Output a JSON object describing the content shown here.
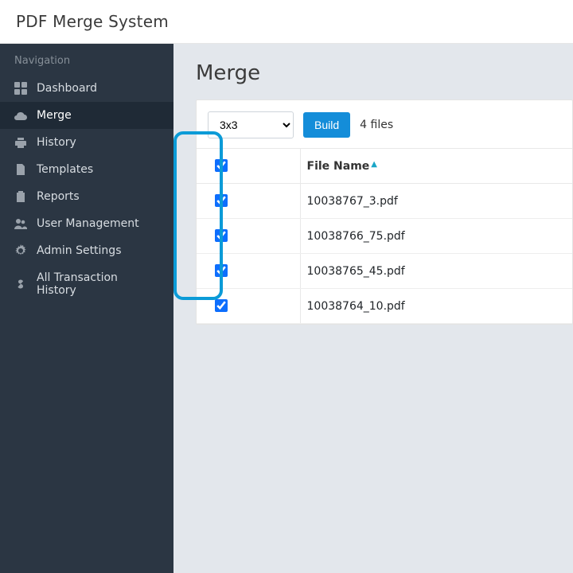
{
  "app": {
    "title": "PDF Merge System"
  },
  "sidebar": {
    "heading": "Navigation",
    "items": [
      {
        "label": "Dashboard"
      },
      {
        "label": "Merge"
      },
      {
        "label": "History"
      },
      {
        "label": "Templates"
      },
      {
        "label": "Reports"
      },
      {
        "label": "User Management"
      },
      {
        "label": "Admin Settings"
      },
      {
        "label": "All Transaction History"
      }
    ]
  },
  "page": {
    "title": "Merge"
  },
  "toolbar": {
    "grid_options": [
      "3x3"
    ],
    "grid_selected": "3x3",
    "build_label": "Build",
    "file_count_text": "4 files"
  },
  "table": {
    "header_filename": "File Name",
    "rows": [
      {
        "file": "10038767_3.pdf"
      },
      {
        "file": "10038766_75.pdf"
      },
      {
        "file": "10038765_45.pdf"
      },
      {
        "file": "10038764_10.pdf"
      }
    ]
  }
}
